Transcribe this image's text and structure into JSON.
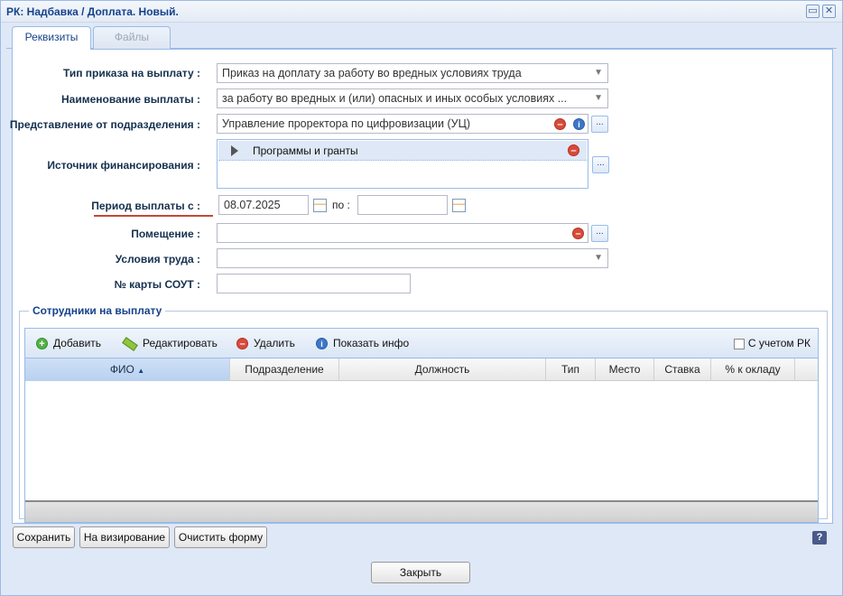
{
  "window": {
    "title": "РК: Надбавка / Доплата. Новый.",
    "restore_glyph": "▭",
    "close_glyph": "✕"
  },
  "tabs": [
    {
      "label": "Реквизиты",
      "active": true
    },
    {
      "label": "Файлы",
      "active": false
    }
  ],
  "form": {
    "order_type_label": "Тип приказа на выплату :",
    "order_type_value": "Приказ на доплату за работу во вредных условиях труда",
    "payment_name_label": "Наименование выплаты :",
    "payment_name_value": "за работу во вредных и (или) опасных и иных особых условиях ...",
    "division_label": "Представление от подразделения :",
    "division_value": "Управление проректора по цифровизации (УЦ)",
    "funding_label": "Источник финансирования :",
    "funding_items": [
      "Программы и гранты"
    ],
    "period_label": "Период выплаты с :",
    "period_from": "08.07.2025",
    "period_to_label": "по :",
    "period_to": "",
    "room_label": "Помещение :",
    "room_value": "",
    "conditions_label": "Условия труда :",
    "conditions_value": "",
    "sout_label": "№ карты СОУТ :",
    "sout_value": ""
  },
  "employees": {
    "legend": "Сотрудники на выплату",
    "toolbar": {
      "add": "Добавить",
      "edit": "Редактировать",
      "delete": "Удалить",
      "info": "Показать инфо",
      "rk_checkbox": "С учетом РК"
    },
    "columns": [
      "ФИО",
      "Подразделение",
      "Должность",
      "Тип",
      "Место",
      "Ставка",
      "% к окладу"
    ],
    "sort_glyph": "▲",
    "rows": []
  },
  "buttons": {
    "save": "Сохранить",
    "approve": "На визирование",
    "clear": "Очистить форму",
    "close": "Закрыть",
    "help": "?"
  },
  "icons": {
    "dots": "...",
    "minus": "–",
    "info": "i",
    "plus": "+"
  },
  "colors": {
    "accent": "#15428b",
    "panel_border": "#99bbe8",
    "period_underline": "#c14a3a"
  }
}
